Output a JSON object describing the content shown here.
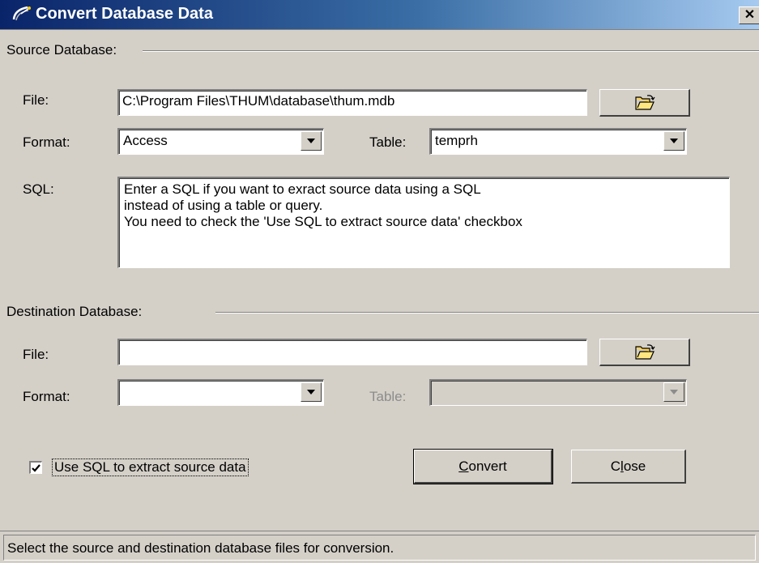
{
  "window": {
    "title": "Convert Database Data",
    "close_glyph": "✕"
  },
  "source": {
    "section_label": "Source Database:",
    "file_label": "File:",
    "file_value": "C:\\Program Files\\THUM\\database\\thum.mdb",
    "format_label": "Format:",
    "format_value": "Access",
    "table_label": "Table:",
    "table_value": "temprh",
    "sql_label": "SQL:",
    "sql_value": "Enter a SQL if you want to exract source data using a SQL\ninstead of using a table or query.\nYou need to check the 'Use SQL to extract source data' checkbox"
  },
  "destination": {
    "section_label": "Destination Database:",
    "file_label": "File:",
    "file_value": "",
    "format_label": "Format:",
    "format_value": "",
    "table_label": "Table:",
    "table_value": ""
  },
  "options": {
    "use_sql_label": "Use SQL to extract source data",
    "use_sql_checked": true
  },
  "buttons": {
    "convert_prefix": "C",
    "convert_rest": "onvert",
    "close_prefix": "C",
    "close_underlined": "l",
    "close_rest": "ose"
  },
  "status": {
    "text": "Select the source and destination database files for conversion."
  },
  "icons": {
    "title": "satellite-dish-icon",
    "browse": "open-folder-icon"
  },
  "colors": {
    "titlebar_start": "#0a246a",
    "titlebar_end": "#a6caf0",
    "face": "#d4d0c8"
  }
}
